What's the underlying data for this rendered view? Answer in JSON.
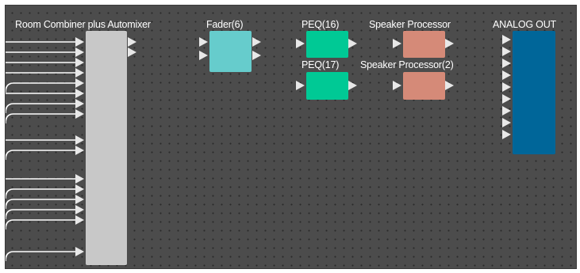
{
  "canvas": {
    "background": "#4c4c4c"
  },
  "components": {
    "room_combiner": {
      "label": "Room Combiner plus Automixer",
      "color": "#c8c8c8"
    },
    "fader": {
      "label": "Fader(6)",
      "color": "#66cccc"
    },
    "peq16": {
      "label": "PEQ(16)",
      "color": "#00c995"
    },
    "peq17": {
      "label": "PEQ(17)",
      "color": "#00c995"
    },
    "speaker_processor": {
      "label": "Speaker Processor",
      "color": "#d58a78"
    },
    "speaker_processor2": {
      "label": "Speaker Processor(2)",
      "color": "#d58a78"
    },
    "analog_out": {
      "label": "ANALOG OUT",
      "color": "#006699"
    }
  },
  "port_color": "#e8e8e8",
  "wire_color": "#ffffff"
}
